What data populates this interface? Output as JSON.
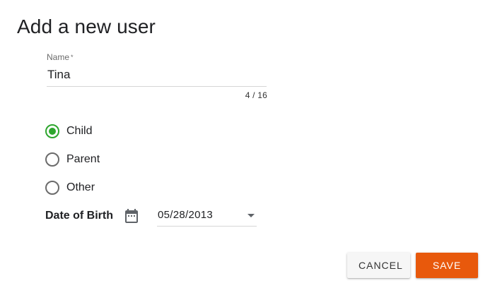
{
  "dialog": {
    "title": "Add a new user"
  },
  "name_field": {
    "label": "Name",
    "required_mark": "*",
    "value": "Tina",
    "counter": "4 / 16"
  },
  "role": {
    "options": [
      {
        "label": "Child",
        "selected": true
      },
      {
        "label": "Parent",
        "selected": false
      },
      {
        "label": "Other",
        "selected": false
      }
    ]
  },
  "dob": {
    "label": "Date of Birth",
    "value": "05/28/2013"
  },
  "actions": {
    "cancel_label": "CANCEL",
    "save_label": "SAVE"
  },
  "colors": {
    "accent_selected": "#2ea62e",
    "primary_button": "#e8590c"
  },
  "icons": {
    "dob_icon": "calendar-icon",
    "dropdown_icon": "chevron-down-icon"
  }
}
